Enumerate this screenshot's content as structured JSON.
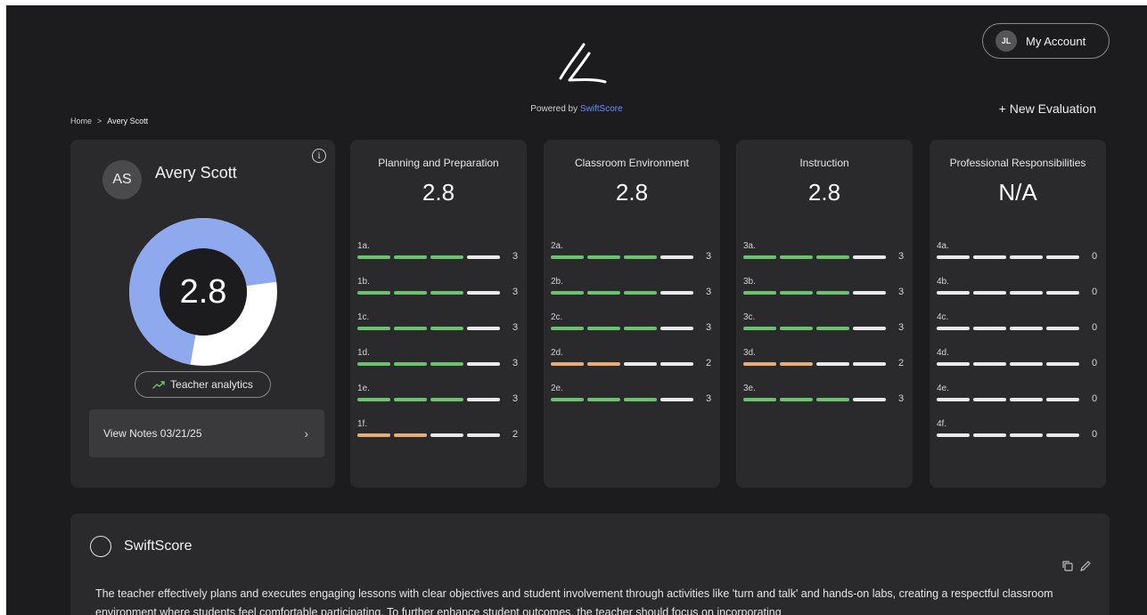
{
  "header": {
    "powered_prefix": "Powered by",
    "brand": "SwiftScore",
    "account_initials": "JL",
    "account_label": "My Account",
    "new_evaluation": "+ New Evaluation"
  },
  "breadcrumb": {
    "home": "Home",
    "separator": ">",
    "current": "Avery Scott"
  },
  "teacher": {
    "initials": "AS",
    "name": "Avery Scott",
    "overall_score": "2.8",
    "donut_fraction": 0.7,
    "analytics_label": "Teacher analytics",
    "notes_label": "View Notes 03/21/25"
  },
  "domains": [
    {
      "title": "Planning and Preparation",
      "score": "2.8",
      "components": [
        {
          "label": "1a.",
          "value": 3
        },
        {
          "label": "1b.",
          "value": 3
        },
        {
          "label": "1c.",
          "value": 3
        },
        {
          "label": "1d.",
          "value": 3
        },
        {
          "label": "1e.",
          "value": 3
        },
        {
          "label": "1f.",
          "value": 2
        }
      ]
    },
    {
      "title": "Classroom Environment",
      "score": "2.8",
      "components": [
        {
          "label": "2a.",
          "value": 3
        },
        {
          "label": "2b.",
          "value": 3
        },
        {
          "label": "2c.",
          "value": 3
        },
        {
          "label": "2d.",
          "value": 2
        },
        {
          "label": "2e.",
          "value": 3
        }
      ]
    },
    {
      "title": "Instruction",
      "score": "2.8",
      "components": [
        {
          "label": "3a.",
          "value": 3
        },
        {
          "label": "3b.",
          "value": 3
        },
        {
          "label": "3c.",
          "value": 3
        },
        {
          "label": "3d.",
          "value": 2
        },
        {
          "label": "3e.",
          "value": 3
        }
      ]
    },
    {
      "title": "Professional Responsibilities",
      "score": "N/A",
      "components": [
        {
          "label": "4a.",
          "value": 0
        },
        {
          "label": "4b.",
          "value": 0
        },
        {
          "label": "4c.",
          "value": 0
        },
        {
          "label": "4d.",
          "value": 0
        },
        {
          "label": "4e.",
          "value": 0
        },
        {
          "label": "4f.",
          "value": 0
        }
      ]
    }
  ],
  "summary": {
    "title": "SwiftScore",
    "text": "The teacher effectively plans and executes engaging lessons with clear objectives and student involvement through activities like 'turn and talk' and hands-on labs, creating a respectful classroom environment where students feel comfortable participating. To further enhance student outcomes, the teacher should focus on incorporating"
  },
  "colors": {
    "background": "#1c1c1e",
    "card": "#2a2a2c",
    "accent_blue": "#8fa9ee",
    "score_green": "#6ac46b",
    "score_orange": "#e8ad76",
    "bar_empty": "#e9e9e9",
    "brand_link": "#6b8cff"
  }
}
